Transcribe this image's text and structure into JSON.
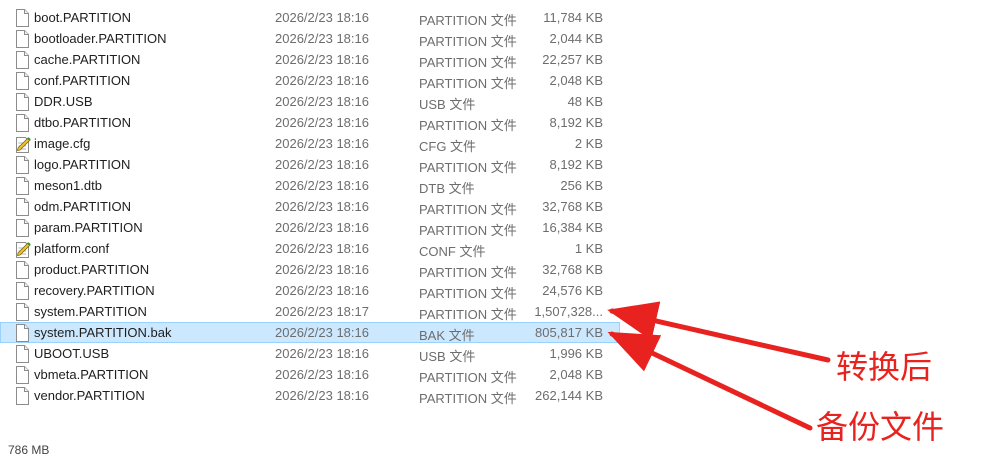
{
  "files": [
    {
      "name": "boot.PARTITION",
      "date": "2026/2/23 18:16",
      "type": "PARTITION 文件",
      "size": "11,784 KB",
      "icon": "file-icon"
    },
    {
      "name": "bootloader.PARTITION",
      "date": "2026/2/23 18:16",
      "type": "PARTITION 文件",
      "size": "2,044 KB",
      "icon": "file-icon"
    },
    {
      "name": "cache.PARTITION",
      "date": "2026/2/23 18:16",
      "type": "PARTITION 文件",
      "size": "22,257 KB",
      "icon": "file-icon"
    },
    {
      "name": "conf.PARTITION",
      "date": "2026/2/23 18:16",
      "type": "PARTITION 文件",
      "size": "2,048 KB",
      "icon": "file-icon"
    },
    {
      "name": "DDR.USB",
      "date": "2026/2/23 18:16",
      "type": "USB 文件",
      "size": "48 KB",
      "icon": "file-icon"
    },
    {
      "name": "dtbo.PARTITION",
      "date": "2026/2/23 18:16",
      "type": "PARTITION 文件",
      "size": "8,192 KB",
      "icon": "file-icon"
    },
    {
      "name": "image.cfg",
      "date": "2026/2/23 18:16",
      "type": "CFG 文件",
      "size": "2 KB",
      "icon": "config-file-icon"
    },
    {
      "name": "logo.PARTITION",
      "date": "2026/2/23 18:16",
      "type": "PARTITION 文件",
      "size": "8,192 KB",
      "icon": "file-icon"
    },
    {
      "name": "meson1.dtb",
      "date": "2026/2/23 18:16",
      "type": "DTB 文件",
      "size": "256 KB",
      "icon": "file-icon"
    },
    {
      "name": "odm.PARTITION",
      "date": "2026/2/23 18:16",
      "type": "PARTITION 文件",
      "size": "32,768 KB",
      "icon": "file-icon"
    },
    {
      "name": "param.PARTITION",
      "date": "2026/2/23 18:16",
      "type": "PARTITION 文件",
      "size": "16,384 KB",
      "icon": "file-icon"
    },
    {
      "name": "platform.conf",
      "date": "2026/2/23 18:16",
      "type": "CONF 文件",
      "size": "1 KB",
      "icon": "config-file-icon"
    },
    {
      "name": "product.PARTITION",
      "date": "2026/2/23 18:16",
      "type": "PARTITION 文件",
      "size": "32,768 KB",
      "icon": "file-icon"
    },
    {
      "name": "recovery.PARTITION",
      "date": "2026/2/23 18:16",
      "type": "PARTITION 文件",
      "size": "24,576 KB",
      "icon": "file-icon"
    },
    {
      "name": "system.PARTITION",
      "date": "2026/2/23 18:17",
      "type": "PARTITION 文件",
      "size": "1,507,328...",
      "icon": "file-icon"
    },
    {
      "name": "system.PARTITION.bak",
      "date": "2026/2/23 18:16",
      "type": "BAK 文件",
      "size": "805,817 KB",
      "icon": "file-icon",
      "selected": true
    },
    {
      "name": "UBOOT.USB",
      "date": "2026/2/23 18:16",
      "type": "USB 文件",
      "size": "1,996 KB",
      "icon": "file-icon"
    },
    {
      "name": "vbmeta.PARTITION",
      "date": "2026/2/23 18:16",
      "type": "PARTITION 文件",
      "size": "2,048 KB",
      "icon": "file-icon"
    },
    {
      "name": "vendor.PARTITION",
      "date": "2026/2/23 18:16",
      "type": "PARTITION 文件",
      "size": "262,144 KB",
      "icon": "file-icon"
    }
  ],
  "status": {
    "size_text": "786 MB"
  },
  "annotations": {
    "converted_label": "转换后",
    "backup_label": "备份文件"
  },
  "colors": {
    "selection_bg": "#cce8ff",
    "selection_border": "#99d1ff",
    "annotation_red": "#e8231f"
  }
}
